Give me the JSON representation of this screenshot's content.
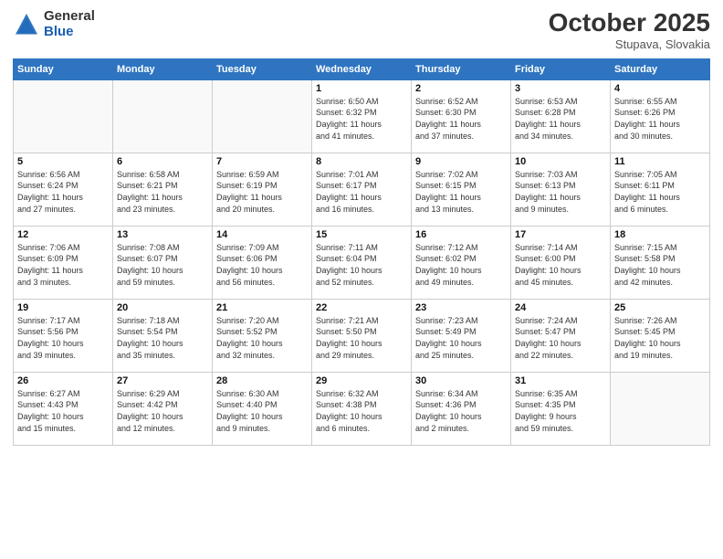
{
  "header": {
    "logo_general": "General",
    "logo_blue": "Blue",
    "month": "October 2025",
    "location": "Stupava, Slovakia"
  },
  "weekdays": [
    "Sunday",
    "Monday",
    "Tuesday",
    "Wednesday",
    "Thursday",
    "Friday",
    "Saturday"
  ],
  "weeks": [
    [
      {
        "day": "",
        "info": ""
      },
      {
        "day": "",
        "info": ""
      },
      {
        "day": "",
        "info": ""
      },
      {
        "day": "1",
        "info": "Sunrise: 6:50 AM\nSunset: 6:32 PM\nDaylight: 11 hours\nand 41 minutes."
      },
      {
        "day": "2",
        "info": "Sunrise: 6:52 AM\nSunset: 6:30 PM\nDaylight: 11 hours\nand 37 minutes."
      },
      {
        "day": "3",
        "info": "Sunrise: 6:53 AM\nSunset: 6:28 PM\nDaylight: 11 hours\nand 34 minutes."
      },
      {
        "day": "4",
        "info": "Sunrise: 6:55 AM\nSunset: 6:26 PM\nDaylight: 11 hours\nand 30 minutes."
      }
    ],
    [
      {
        "day": "5",
        "info": "Sunrise: 6:56 AM\nSunset: 6:24 PM\nDaylight: 11 hours\nand 27 minutes."
      },
      {
        "day": "6",
        "info": "Sunrise: 6:58 AM\nSunset: 6:21 PM\nDaylight: 11 hours\nand 23 minutes."
      },
      {
        "day": "7",
        "info": "Sunrise: 6:59 AM\nSunset: 6:19 PM\nDaylight: 11 hours\nand 20 minutes."
      },
      {
        "day": "8",
        "info": "Sunrise: 7:01 AM\nSunset: 6:17 PM\nDaylight: 11 hours\nand 16 minutes."
      },
      {
        "day": "9",
        "info": "Sunrise: 7:02 AM\nSunset: 6:15 PM\nDaylight: 11 hours\nand 13 minutes."
      },
      {
        "day": "10",
        "info": "Sunrise: 7:03 AM\nSunset: 6:13 PM\nDaylight: 11 hours\nand 9 minutes."
      },
      {
        "day": "11",
        "info": "Sunrise: 7:05 AM\nSunset: 6:11 PM\nDaylight: 11 hours\nand 6 minutes."
      }
    ],
    [
      {
        "day": "12",
        "info": "Sunrise: 7:06 AM\nSunset: 6:09 PM\nDaylight: 11 hours\nand 3 minutes."
      },
      {
        "day": "13",
        "info": "Sunrise: 7:08 AM\nSunset: 6:07 PM\nDaylight: 10 hours\nand 59 minutes."
      },
      {
        "day": "14",
        "info": "Sunrise: 7:09 AM\nSunset: 6:06 PM\nDaylight: 10 hours\nand 56 minutes."
      },
      {
        "day": "15",
        "info": "Sunrise: 7:11 AM\nSunset: 6:04 PM\nDaylight: 10 hours\nand 52 minutes."
      },
      {
        "day": "16",
        "info": "Sunrise: 7:12 AM\nSunset: 6:02 PM\nDaylight: 10 hours\nand 49 minutes."
      },
      {
        "day": "17",
        "info": "Sunrise: 7:14 AM\nSunset: 6:00 PM\nDaylight: 10 hours\nand 45 minutes."
      },
      {
        "day": "18",
        "info": "Sunrise: 7:15 AM\nSunset: 5:58 PM\nDaylight: 10 hours\nand 42 minutes."
      }
    ],
    [
      {
        "day": "19",
        "info": "Sunrise: 7:17 AM\nSunset: 5:56 PM\nDaylight: 10 hours\nand 39 minutes."
      },
      {
        "day": "20",
        "info": "Sunrise: 7:18 AM\nSunset: 5:54 PM\nDaylight: 10 hours\nand 35 minutes."
      },
      {
        "day": "21",
        "info": "Sunrise: 7:20 AM\nSunset: 5:52 PM\nDaylight: 10 hours\nand 32 minutes."
      },
      {
        "day": "22",
        "info": "Sunrise: 7:21 AM\nSunset: 5:50 PM\nDaylight: 10 hours\nand 29 minutes."
      },
      {
        "day": "23",
        "info": "Sunrise: 7:23 AM\nSunset: 5:49 PM\nDaylight: 10 hours\nand 25 minutes."
      },
      {
        "day": "24",
        "info": "Sunrise: 7:24 AM\nSunset: 5:47 PM\nDaylight: 10 hours\nand 22 minutes."
      },
      {
        "day": "25",
        "info": "Sunrise: 7:26 AM\nSunset: 5:45 PM\nDaylight: 10 hours\nand 19 minutes."
      }
    ],
    [
      {
        "day": "26",
        "info": "Sunrise: 6:27 AM\nSunset: 4:43 PM\nDaylight: 10 hours\nand 15 minutes."
      },
      {
        "day": "27",
        "info": "Sunrise: 6:29 AM\nSunset: 4:42 PM\nDaylight: 10 hours\nand 12 minutes."
      },
      {
        "day": "28",
        "info": "Sunrise: 6:30 AM\nSunset: 4:40 PM\nDaylight: 10 hours\nand 9 minutes."
      },
      {
        "day": "29",
        "info": "Sunrise: 6:32 AM\nSunset: 4:38 PM\nDaylight: 10 hours\nand 6 minutes."
      },
      {
        "day": "30",
        "info": "Sunrise: 6:34 AM\nSunset: 4:36 PM\nDaylight: 10 hours\nand 2 minutes."
      },
      {
        "day": "31",
        "info": "Sunrise: 6:35 AM\nSunset: 4:35 PM\nDaylight: 9 hours\nand 59 minutes."
      },
      {
        "day": "",
        "info": ""
      }
    ]
  ]
}
